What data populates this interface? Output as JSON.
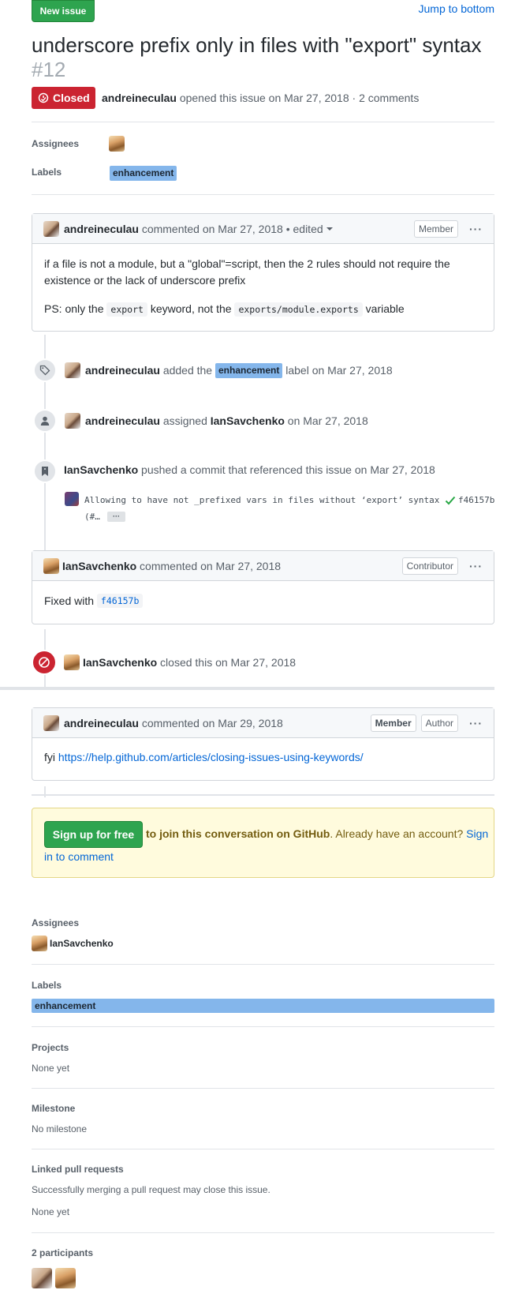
{
  "header": {
    "new_issue_label": "New issue",
    "jump_label": "Jump to bottom",
    "title": "underscore prefix only in files with \"export\" syntax",
    "number": "#12"
  },
  "state": {
    "badge_label": "Closed",
    "author": "andreineculau",
    "meta": "opened this issue on Mar 27, 2018 · 2 comments"
  },
  "top_meta": {
    "assignees_label": "Assignees",
    "labels_label": "Labels",
    "label_name": "enhancement"
  },
  "comment1": {
    "author": "andreineculau",
    "meta": "commented on Mar 27, 2018",
    "edited": "• edited",
    "role": "Member",
    "menu": "···",
    "body_line1": "if a file is not a module, but a \"global\"=script, then the 2 rules should not require the",
    "body_line2": "existence or the lack of underscore prefix",
    "ps_prefix": "PS: only the",
    "ps_code1": "export",
    "ps_mid": "keyword, not the",
    "ps_code2": "exports/module.exports",
    "ps_suffix": "variable"
  },
  "event_label": {
    "actor": "andreineculau",
    "action": "added the",
    "label": "enhancement",
    "suffix": "label on Mar 27, 2018"
  },
  "event_assign": {
    "actor": "andreineculau",
    "action": "assigned",
    "target": "IanSavchenko",
    "suffix": "on Mar 27, 2018"
  },
  "event_commit": {
    "actor": "IanSavchenko",
    "action": "pushed a commit that referenced this issue",
    "suffix": "on Mar 27, 2018",
    "message": "Allowing to have not _prefixed vars in files without ‘export’ syntax",
    "message_cont": "(#…",
    "ellipsis": "···",
    "sha": "f46157b"
  },
  "comment2": {
    "author": "IanSavchenko",
    "meta": "commented on Mar 27, 2018",
    "role": "Contributor",
    "menu": "···",
    "body_prefix": "Fixed with",
    "body_sha": "f46157b"
  },
  "event_closed": {
    "actor": "IanSavchenko",
    "action": "closed this",
    "suffix": "on Mar 27, 2018"
  },
  "comment3": {
    "author": "andreineculau",
    "meta": "commented on Mar 29, 2018",
    "role": "Member",
    "role2": "Author",
    "menu": "···",
    "body_prefix": "fyi",
    "body_link": "https://help.github.com/articles/closing-issues-using-keywords/"
  },
  "signup": {
    "button": "Sign up for free",
    "text_bold": "to join this conversation on GitHub",
    "text_mid": ". Already have an account?",
    "link_part1": "Sign",
    "link_part2": "in to comment"
  },
  "sidebar": {
    "assignees_title": "Assignees",
    "assignee_name": "IanSavchenko",
    "labels_title": "Labels",
    "label_name": "enhancement",
    "projects_title": "Projects",
    "projects_value": "None yet",
    "milestone_title": "Milestone",
    "milestone_value": "No milestone",
    "linked_title": "Linked pull requests",
    "linked_desc": "Successfully merging a pull request may close this issue.",
    "linked_value": "None yet",
    "participants_title": "2 participants"
  },
  "colors": {
    "closed_red": "#cb2431",
    "green": "#2ea44f",
    "label_blue": "#84b6eb",
    "link": "#0366d6",
    "signup_bg": "#fffbdd"
  }
}
